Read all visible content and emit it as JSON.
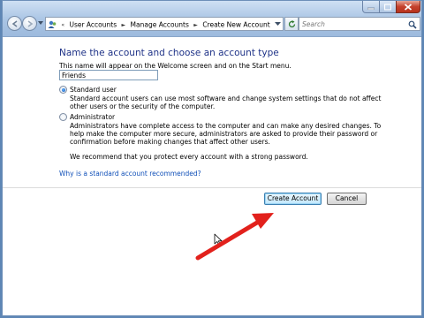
{
  "window": {
    "search_placeholder": "Search"
  },
  "breadcrumb": [
    "User Accounts",
    "Manage Accounts",
    "Create New Account"
  ],
  "page": {
    "heading": "Name the account and choose an account type",
    "subtitle": "This name will appear on the Welcome screen and on the Start menu.",
    "account_name_value": "Friends",
    "standard_label": "Standard user",
    "standard_desc": "Standard account users can use most software and change system settings that do not affect other users or the security of the computer.",
    "admin_label": "Administrator",
    "admin_desc": "Administrators have complete access to the computer and can make any desired changes. To help make the computer more secure, administrators are asked to provide their password or confirmation before making changes that affect other users.",
    "password_note": "We recommend that you protect every account with a strong password.",
    "help_link": "Why is a standard account recommended?",
    "create_button": "Create Account",
    "cancel_button": "Cancel",
    "selected_account_type": "Standard user"
  },
  "colors": {
    "heading": "#1e3287",
    "link": "#0f4fb8",
    "annotation_arrow": "#e2211c"
  },
  "icons": [
    "back-icon",
    "forward-icon",
    "user-accounts-icon",
    "refresh-icon",
    "search-icon",
    "mouse-cursor-icon",
    "red-arrow-annotation"
  ]
}
